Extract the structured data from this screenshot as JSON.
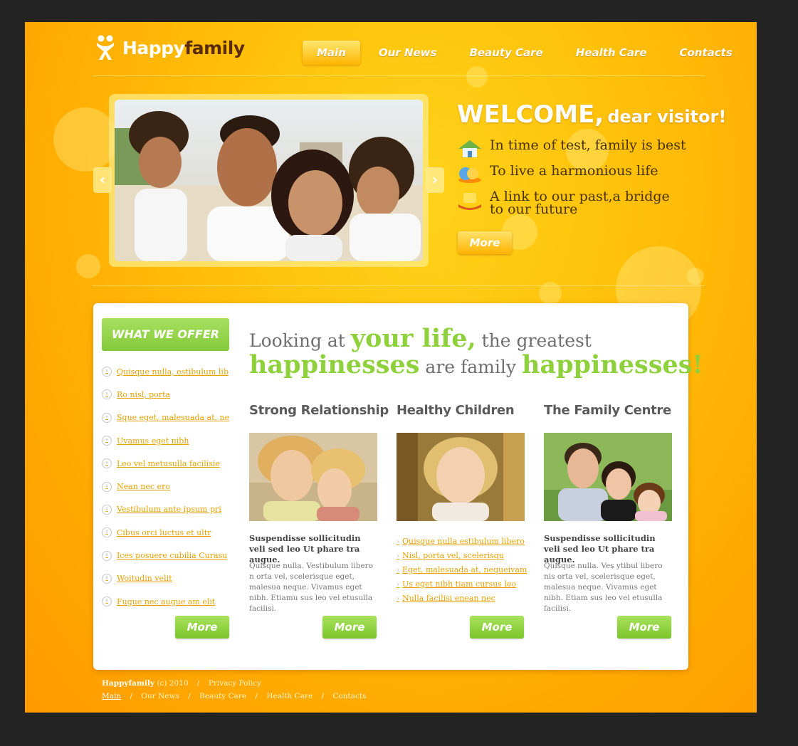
{
  "brand": {
    "name_light": "Happy",
    "name_dark": "family"
  },
  "nav": {
    "items": [
      {
        "label": "Main",
        "active": true
      },
      {
        "label": "Our News"
      },
      {
        "label": "Beauty Care"
      },
      {
        "label": "Health Care"
      },
      {
        "label": "Contacts"
      }
    ]
  },
  "hero": {
    "prev_arrow": "‹",
    "next_arrow": "›",
    "welcome_big": "WELCOME,",
    "welcome_small": "dear visitor!",
    "features": [
      {
        "icon": "house-icon",
        "text": "In time of test, family is best"
      },
      {
        "icon": "globe-icon",
        "text": "To live a harmonious life"
      },
      {
        "icon": "bridge-icon",
        "text": "A link to our past,a bridge to our future"
      }
    ],
    "more_label": "More"
  },
  "offer": {
    "title": "WHAT WE OFFER",
    "items": [
      "Quisque nulla, estibulum lib",
      "Ro nisl, porta",
      "Sque eget, malesuada at, ne",
      "Uvamus eget nibh",
      "Leo vel metusulla facilisie",
      "Nean nec ero",
      "Vestibulum ante ipsum pri",
      "Cibus orci luctus et ultr",
      "Ices posuere cubilia Curasu",
      "Woitudin velit",
      "Fugue nec augue am elit"
    ],
    "more_label": "More"
  },
  "tagline": {
    "p1": "Looking at ",
    "p2": "your life,",
    "p3": " the greatest",
    "p4": "happinesses",
    "p5": " are family ",
    "p6": "happinesses!"
  },
  "columns": [
    {
      "title": "Strong Relationship",
      "bold": "Suspendisse sollicitudin veli sed leo Ut phare tra augue.",
      "text": "Quisque nulla. Vestibulum libero n orta vel, scelerisque eget, malesua neque. Vivamus eget nibh. Etiamu sus leo vel etusulla facilisi.",
      "more_label": "More"
    },
    {
      "title": "Healthy Children",
      "links": [
        "Quisque nulla estibulum libero",
        "Nisl, porta vel, scelerisqu",
        "Eget, malesuada at, nequeivam",
        "Us eget nibh tiam cursus leo",
        "Nulla facilisi enean nec"
      ],
      "more_label": "More"
    },
    {
      "title": "The Family Centre",
      "bold": "Suspendisse sollicitudin veli sed leo Ut phare tra augue.",
      "text": "Quisque nulla. Ves ytibul libero nis orta vel, scelerisque eget, malesua neque. Vivamus eget nibh. Etiam sus leo vel etusulla facilisi.",
      "more_label": "More"
    }
  ],
  "footer": {
    "brand": "Happyfamily",
    "copyright": "(c) 2010",
    "separator": "/",
    "privacy": "Privacy Policy",
    "links": [
      "Main",
      "Our News",
      "Beauty Care",
      "Health Care",
      "Contacts"
    ]
  },
  "colors": {
    "accent_green": "#8fd13c",
    "link_orange": "#e8a200",
    "bg_orange": "#ffb400",
    "frame": "#232323"
  }
}
